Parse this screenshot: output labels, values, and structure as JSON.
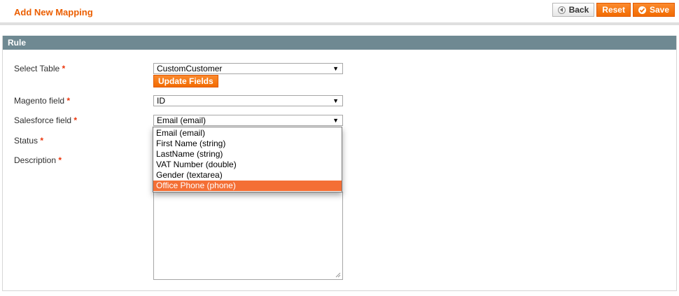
{
  "header": {
    "title": "Add New Mapping",
    "buttons": {
      "back": "Back",
      "reset": "Reset",
      "save": "Save"
    }
  },
  "section": {
    "title": "Rule"
  },
  "form": {
    "select_table": {
      "label": "Select Table",
      "value": "CustomCustomer"
    },
    "update_fields_label": "Update Fields",
    "magento_field": {
      "label": "Magento field",
      "value": "ID"
    },
    "salesforce_field": {
      "label": "Salesforce field",
      "value": "Email (email)"
    },
    "status": {
      "label": "Status"
    },
    "description": {
      "label": "Description"
    },
    "required_mark": "*"
  },
  "dropdown": {
    "options": [
      "Email (email)",
      "First Name (string)",
      "LastName (string)",
      "VAT Number (double)",
      "Gender (textarea)",
      "Office Phone (phone)"
    ],
    "highlighted": "Office Phone (phone)"
  },
  "colors": {
    "accent": "#eb5e00",
    "section_header": "#6f8992",
    "highlight": "#f46f35"
  }
}
